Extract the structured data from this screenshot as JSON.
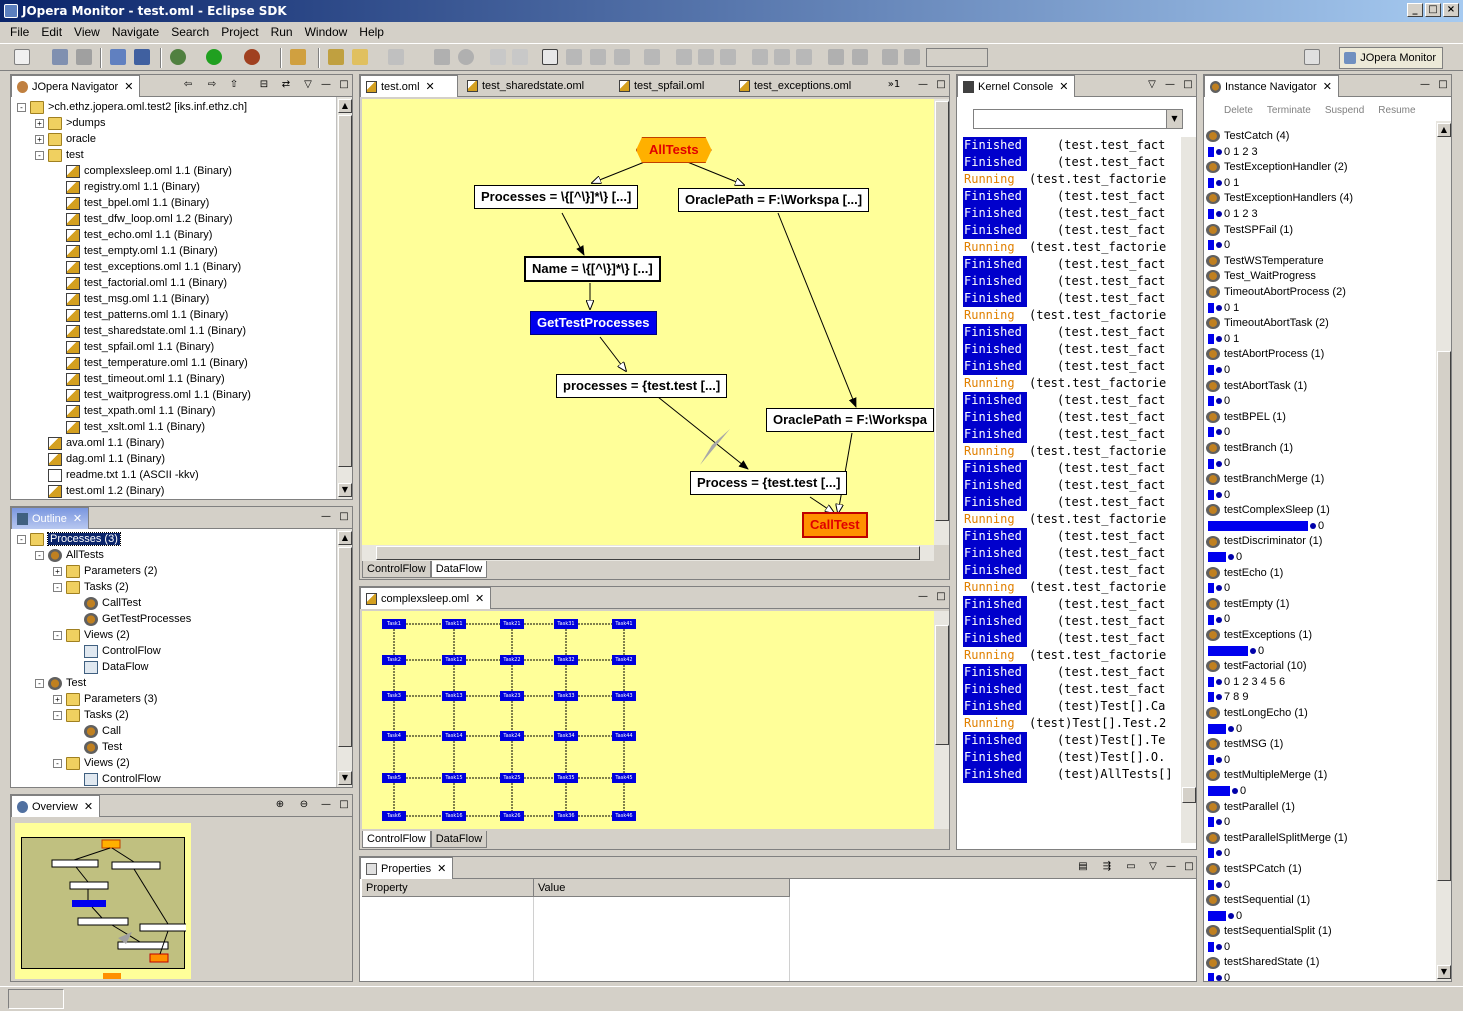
{
  "window": {
    "title": "JOpera Monitor - test.oml - Eclipse SDK"
  },
  "menu": [
    "File",
    "Edit",
    "View",
    "Navigate",
    "Search",
    "Project",
    "Run",
    "Window",
    "Help"
  ],
  "toolbar": {
    "perspective": "JOpera Monitor"
  },
  "navigator": {
    "tab": "JOpera Navigator",
    "items": [
      {
        "depth": 0,
        "exp": "-",
        "icon": "project",
        "label": ">ch.ethz.jopera.oml.test2  [iks.inf.ethz.ch]"
      },
      {
        "depth": 1,
        "exp": "+",
        "icon": "folder",
        "label": ">dumps"
      },
      {
        "depth": 1,
        "exp": "+",
        "icon": "folder",
        "label": "oracle"
      },
      {
        "depth": 1,
        "exp": "-",
        "icon": "folder",
        "label": "test"
      },
      {
        "depth": 2,
        "exp": "",
        "icon": "oml",
        "label": "complexsleep.oml  1.1  (Binary)"
      },
      {
        "depth": 2,
        "exp": "",
        "icon": "oml",
        "label": "registry.oml  1.1  (Binary)"
      },
      {
        "depth": 2,
        "exp": "",
        "icon": "oml",
        "label": "test_bpel.oml  1.1  (Binary)"
      },
      {
        "depth": 2,
        "exp": "",
        "icon": "oml",
        "label": "test_dfw_loop.oml  1.2  (Binary)"
      },
      {
        "depth": 2,
        "exp": "",
        "icon": "oml",
        "label": "test_echo.oml  1.1  (Binary)"
      },
      {
        "depth": 2,
        "exp": "",
        "icon": "oml",
        "label": "test_empty.oml  1.1  (Binary)"
      },
      {
        "depth": 2,
        "exp": "",
        "icon": "oml",
        "label": "test_exceptions.oml  1.1  (Binary)"
      },
      {
        "depth": 2,
        "exp": "",
        "icon": "oml",
        "label": "test_factorial.oml  1.1  (Binary)"
      },
      {
        "depth": 2,
        "exp": "",
        "icon": "oml",
        "label": "test_msg.oml  1.1  (Binary)"
      },
      {
        "depth": 2,
        "exp": "",
        "icon": "oml",
        "label": "test_patterns.oml  1.1  (Binary)"
      },
      {
        "depth": 2,
        "exp": "",
        "icon": "oml",
        "label": "test_sharedstate.oml  1.1  (Binary)"
      },
      {
        "depth": 2,
        "exp": "",
        "icon": "oml",
        "label": "test_spfail.oml  1.1  (Binary)"
      },
      {
        "depth": 2,
        "exp": "",
        "icon": "oml",
        "label": "test_temperature.oml  1.1  (Binary)"
      },
      {
        "depth": 2,
        "exp": "",
        "icon": "oml",
        "label": "test_timeout.oml  1.1  (Binary)"
      },
      {
        "depth": 2,
        "exp": "",
        "icon": "oml",
        "label": "test_waitprogress.oml  1.1  (Binary)"
      },
      {
        "depth": 2,
        "exp": "",
        "icon": "oml",
        "label": "test_xpath.oml  1.1  (Binary)"
      },
      {
        "depth": 2,
        "exp": "",
        "icon": "oml",
        "label": "test_xslt.oml  1.1  (Binary)"
      },
      {
        "depth": 1,
        "exp": "",
        "icon": "oml",
        "label": "ava.oml  1.1  (Binary)"
      },
      {
        "depth": 1,
        "exp": "",
        "icon": "oml",
        "label": "dag.oml  1.1  (Binary)"
      },
      {
        "depth": 1,
        "exp": "",
        "icon": "file",
        "label": "readme.txt  1.1  (ASCII -kkv)"
      },
      {
        "depth": 1,
        "exp": "",
        "icon": "oml",
        "label": "test.oml  1.2  (Binary)"
      }
    ]
  },
  "outline": {
    "tab": "Outline",
    "items": [
      {
        "depth": 0,
        "exp": "-",
        "icon": "folder",
        "label": "Processes (3)",
        "selected": true
      },
      {
        "depth": 1,
        "exp": "-",
        "icon": "proc",
        "label": "AllTests"
      },
      {
        "depth": 2,
        "exp": "+",
        "icon": "folder",
        "label": "Parameters (2)"
      },
      {
        "depth": 2,
        "exp": "-",
        "icon": "folder",
        "label": "Tasks (2)"
      },
      {
        "depth": 3,
        "exp": "",
        "icon": "proc",
        "label": "CallTest"
      },
      {
        "depth": 3,
        "exp": "",
        "icon": "proc",
        "label": "GetTestProcesses"
      },
      {
        "depth": 2,
        "exp": "-",
        "icon": "folder",
        "label": "Views (2)"
      },
      {
        "depth": 3,
        "exp": "",
        "icon": "view",
        "label": "ControlFlow"
      },
      {
        "depth": 3,
        "exp": "",
        "icon": "view",
        "label": "DataFlow"
      },
      {
        "depth": 1,
        "exp": "-",
        "icon": "proc",
        "label": "Test"
      },
      {
        "depth": 2,
        "exp": "+",
        "icon": "folder",
        "label": "Parameters (3)"
      },
      {
        "depth": 2,
        "exp": "-",
        "icon": "folder",
        "label": "Tasks (2)"
      },
      {
        "depth": 3,
        "exp": "",
        "icon": "proc",
        "label": "Call"
      },
      {
        "depth": 3,
        "exp": "",
        "icon": "proc",
        "label": "Test"
      },
      {
        "depth": 2,
        "exp": "-",
        "icon": "folder",
        "label": "Views (2)"
      },
      {
        "depth": 3,
        "exp": "",
        "icon": "view",
        "label": "ControlFlow"
      }
    ]
  },
  "overview": {
    "tab": "Overview"
  },
  "editor": {
    "tabs": [
      "test.oml",
      "test_sharedstate.oml",
      "test_spfail.oml",
      "test_exceptions.oml"
    ],
    "overflow": "»1",
    "nodes": {
      "alltests": "AllTests",
      "processes": "Processes = \\{[^\\}]*\\} [...]",
      "oraclepath1": "OraclePath = F:\\Workspa [...]",
      "name": "Name = \\{[^\\}]*\\} [...]",
      "gettest": "GetTestProcesses",
      "processes2": "processes = {test.test [...]",
      "oraclepath2": "OraclePath = F:\\Workspa",
      "process": "Process = {test.test [...]",
      "calltest": "CallTest"
    },
    "bottom_tabs": [
      "ControlFlow",
      "DataFlow"
    ]
  },
  "editor2": {
    "tab": "complexsleep.oml",
    "grid": [
      [
        "Task1",
        "Task11",
        "Task21",
        "Task31",
        "Task41"
      ],
      [
        "Task2",
        "Task12",
        "Task22",
        "Task32",
        "Task42"
      ],
      [
        "Task3",
        "Task13",
        "Task23",
        "Task33",
        "Task43"
      ],
      [
        "Task4",
        "Task14",
        "Task24",
        "Task34",
        "Task44"
      ],
      [
        "Task5",
        "Task15",
        "Task25",
        "Task35",
        "Task45"
      ],
      [
        "Task6",
        "Task16",
        "Task26",
        "Task36",
        "Task46"
      ]
    ],
    "bottom_tabs": [
      "ControlFlow",
      "DataFlow"
    ]
  },
  "console": {
    "tab": "Kernel Console",
    "lines": [
      [
        "Finished",
        "(test.test_fact"
      ],
      [
        "Finished",
        "(test.test_fact"
      ],
      [
        "Running",
        "(test.test_factorie"
      ],
      [
        "Finished",
        "(test.test_fact"
      ],
      [
        "Finished",
        "(test.test_fact"
      ],
      [
        "Finished",
        "(test.test_fact"
      ],
      [
        "Running",
        "(test.test_factorie"
      ],
      [
        "Finished",
        "(test.test_fact"
      ],
      [
        "Finished",
        "(test.test_fact"
      ],
      [
        "Finished",
        "(test.test_fact"
      ],
      [
        "Running",
        "(test.test_factorie"
      ],
      [
        "Finished",
        "(test.test_fact"
      ],
      [
        "Finished",
        "(test.test_fact"
      ],
      [
        "Finished",
        "(test.test_fact"
      ],
      [
        "Running",
        "(test.test_factorie"
      ],
      [
        "Finished",
        "(test.test_fact"
      ],
      [
        "Finished",
        "(test.test_fact"
      ],
      [
        "Finished",
        "(test.test_fact"
      ],
      [
        "Running",
        "(test.test_factorie"
      ],
      [
        "Finished",
        "(test.test_fact"
      ],
      [
        "Finished",
        "(test.test_fact"
      ],
      [
        "Finished",
        "(test.test_fact"
      ],
      [
        "Running",
        "(test.test_factorie"
      ],
      [
        "Finished",
        "(test.test_fact"
      ],
      [
        "Finished",
        "(test.test_fact"
      ],
      [
        "Finished",
        "(test.test_fact"
      ],
      [
        "Running",
        "(test.test_factorie"
      ],
      [
        "Finished",
        "(test.test_fact"
      ],
      [
        "Finished",
        "(test.test_fact"
      ],
      [
        "Finished",
        "(test.test_fact"
      ],
      [
        "Running",
        "(test.test_factorie"
      ],
      [
        "Finished",
        "(test.test_fact"
      ],
      [
        "Finished",
        "(test.test_fact"
      ],
      [
        "Finished",
        "(test)Test[].Ca"
      ],
      [
        "Running",
        "(test)Test[].Test.2"
      ],
      [
        "Finished",
        "(test)Test[].Te"
      ],
      [
        "Finished",
        "(test)Test[].O."
      ],
      [
        "Finished",
        "(test)AllTests[]"
      ]
    ]
  },
  "instances": {
    "tab": "Instance Navigator",
    "toolbar": [
      "Delete",
      "Terminate",
      "Suspend",
      "Resume"
    ],
    "rows": [
      {
        "type": "label",
        "text": "TestCatch (4)"
      },
      {
        "type": "bars",
        "text": "0  1  2  3",
        "w": 0
      },
      {
        "type": "label",
        "text": "TestExceptionHandler (2)"
      },
      {
        "type": "bars",
        "text": "0  1",
        "w": 0
      },
      {
        "type": "label",
        "text": "TestExceptionHandlers (4)"
      },
      {
        "type": "bars",
        "text": "0  1  2  3",
        "w": 0
      },
      {
        "type": "label",
        "text": "TestSPFail (1)"
      },
      {
        "type": "bars",
        "text": "0",
        "w": 0
      },
      {
        "type": "label",
        "text": "TestWSTemperature"
      },
      {
        "type": "label",
        "text": "Test_WaitProgress"
      },
      {
        "type": "label",
        "text": "TimeoutAbortProcess (2)"
      },
      {
        "type": "bars",
        "text": "0  1",
        "w": 0
      },
      {
        "type": "label",
        "text": "TimeoutAbortTask (2)"
      },
      {
        "type": "bars",
        "text": "0  1",
        "w": 0
      },
      {
        "type": "label",
        "text": "testAbortProcess (1)"
      },
      {
        "type": "bars",
        "text": "0",
        "w": 0
      },
      {
        "type": "label",
        "text": "testAbortTask (1)"
      },
      {
        "type": "bars",
        "text": "0",
        "w": 0
      },
      {
        "type": "label",
        "text": "testBPEL (1)"
      },
      {
        "type": "bars",
        "text": "0",
        "w": 0
      },
      {
        "type": "label",
        "text": "testBranch (1)"
      },
      {
        "type": "bars",
        "text": "0",
        "w": 0
      },
      {
        "type": "label",
        "text": "testBranchMerge (1)"
      },
      {
        "type": "bars",
        "text": "0",
        "w": 0
      },
      {
        "type": "label",
        "text": "testComplexSleep (1)"
      },
      {
        "type": "bars",
        "text": "0",
        "w": 100
      },
      {
        "type": "label",
        "text": "testDiscriminator (1)"
      },
      {
        "type": "bars",
        "text": "0",
        "w": 18
      },
      {
        "type": "label",
        "text": "testEcho (1)"
      },
      {
        "type": "bars",
        "text": "0",
        "w": 0
      },
      {
        "type": "label",
        "text": "testEmpty (1)"
      },
      {
        "type": "bars",
        "text": "0",
        "w": 0
      },
      {
        "type": "label",
        "text": "testExceptions (1)"
      },
      {
        "type": "bars",
        "text": "0",
        "w": 40
      },
      {
        "type": "label",
        "text": "testFactorial (10)"
      },
      {
        "type": "bars",
        "text": "0   1   2   3   4   5   6",
        "w": 0
      },
      {
        "type": "bars",
        "text": "7   8   9",
        "w": 0
      },
      {
        "type": "label",
        "text": "testLongEcho (1)"
      },
      {
        "type": "bars",
        "text": "0",
        "w": 18
      },
      {
        "type": "label",
        "text": "testMSG (1)"
      },
      {
        "type": "bars",
        "text": "0",
        "w": 0
      },
      {
        "type": "label",
        "text": "testMultipleMerge (1)"
      },
      {
        "type": "bars",
        "text": "0",
        "w": 22
      },
      {
        "type": "label",
        "text": "testParallel (1)"
      },
      {
        "type": "bars",
        "text": "0",
        "w": 0
      },
      {
        "type": "label",
        "text": "testParallelSplitMerge (1)"
      },
      {
        "type": "bars",
        "text": "0",
        "w": 0
      },
      {
        "type": "label",
        "text": "testSPCatch (1)"
      },
      {
        "type": "bars",
        "text": "0",
        "w": 0
      },
      {
        "type": "label",
        "text": "testSequential (1)"
      },
      {
        "type": "bars",
        "text": "0",
        "w": 18
      },
      {
        "type": "label",
        "text": "testSequentialSplit (1)"
      },
      {
        "type": "bars",
        "text": "0",
        "w": 0
      },
      {
        "type": "label",
        "text": "testSharedState (1)"
      },
      {
        "type": "bars",
        "text": "0",
        "w": 0
      }
    ]
  },
  "properties": {
    "tab": "Properties",
    "columns": [
      "Property",
      "Value"
    ]
  }
}
